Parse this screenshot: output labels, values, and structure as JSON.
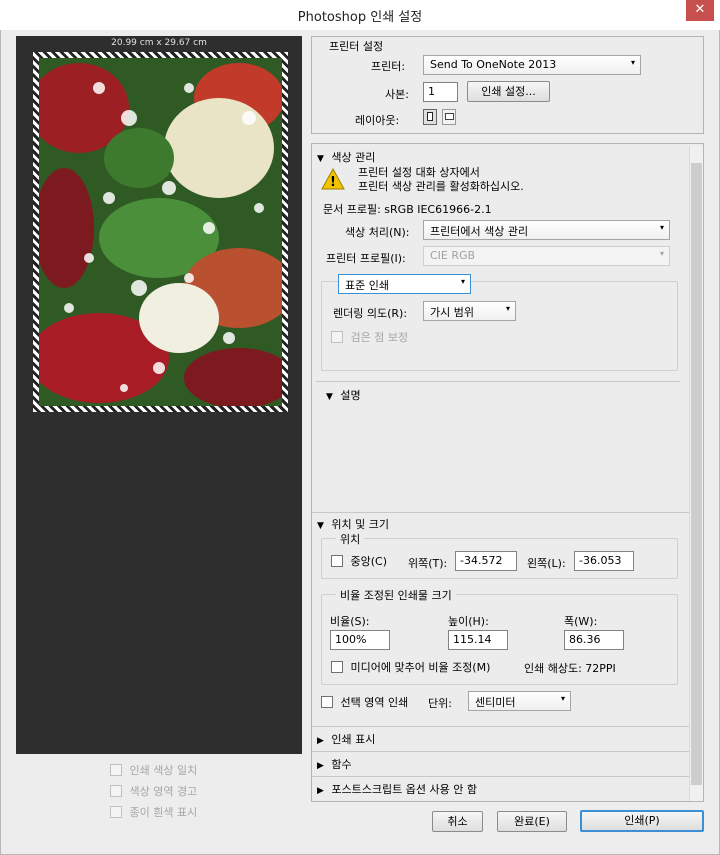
{
  "window": {
    "title": "Photoshop 인쇄 설정",
    "close": "✕"
  },
  "preview": {
    "dimensions": "20.99 cm x 29.67 cm",
    "options": [
      {
        "label": "인쇄 색상 일치"
      },
      {
        "label": "색상 영역 경고"
      },
      {
        "label": "종이 흰색 표시"
      }
    ]
  },
  "printer_settings": {
    "title": "프린터 설정",
    "printer_label": "프린터:",
    "printer_value": "Send To OneNote 2013",
    "copies_label": "사본:",
    "copies_value": "1",
    "print_settings_button": "인쇄 설정...",
    "layout_label": "레이아웃:"
  },
  "color_management": {
    "title": "색상 관리",
    "warning_line1": "프린터 설정 대화 상자에서",
    "warning_line2": "프린터 색상 관리를 활성화하십시오.",
    "doc_profile": "문서 프로필: sRGB IEC61966-2.1",
    "color_handling_label": "색상 처리(N):",
    "color_handling_value": "프린터에서 색상 관리",
    "printer_profile_label": "프린터 프로필(I):",
    "printer_profile_value": "CIE RGB",
    "print_mode_value": "표준 인쇄",
    "rendering_label": "렌더링 의도(R):",
    "rendering_value": "가시 범위",
    "black_point_label": "검은 점 보정"
  },
  "description": {
    "title": "설명"
  },
  "position_size": {
    "title": "위치 및 크기",
    "position_group": "위치",
    "center_label": "중앙(C)",
    "top_label": "위쪽(T):",
    "top_value": "-34.572",
    "left_label": "왼쪽(L):",
    "left_value": "-36.053",
    "scaled_group": "비율 조정된 인쇄물 크기",
    "scale_label": "비율(S):",
    "scale_value": "100%",
    "height_label": "높이(H):",
    "height_value": "115.14",
    "width_label": "폭(W):",
    "width_value": "86.36",
    "fit_media_label": "미디어에 맞추어 비율 조정(M)",
    "resolution_text": "인쇄 해상도: 72PPI",
    "print_selection_label": "선택 영역 인쇄",
    "units_label": "단위:",
    "units_value": "센티미터"
  },
  "collapsed_sections": [
    {
      "title": "인쇄 표시"
    },
    {
      "title": "함수"
    },
    {
      "title": "포스트스크립트 옵션 사용 안 함"
    }
  ],
  "buttons": {
    "cancel": "취소",
    "done": "완료(E)",
    "print": "인쇄(P)"
  },
  "icons": {
    "expanded": "▼",
    "collapsed": "▶",
    "dropdown": "▾",
    "warning": "!"
  },
  "colors": {
    "accent": "#3b8fd6",
    "warning": "#f2c300",
    "close": "#c7504f",
    "preview_bg": "#2e2e2e"
  }
}
